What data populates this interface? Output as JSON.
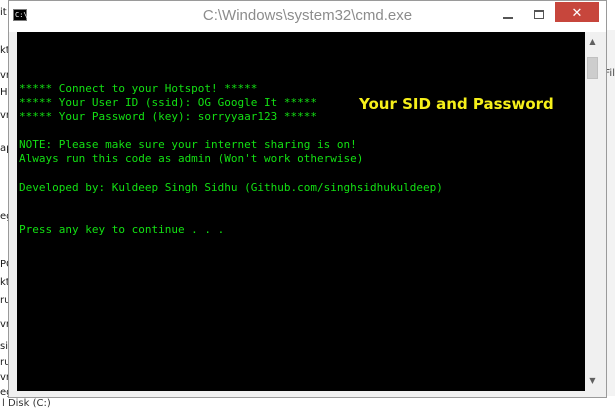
{
  "window": {
    "title": "C:\\Windows\\system32\\cmd.exe",
    "icon_label": "C:\\",
    "minimize_icon": "minimize-icon",
    "maximize_icon": "maximize-icon",
    "close_icon": "close-icon",
    "close_glyph": "✕"
  },
  "console": {
    "lines": [
      "***** Connect to your Hotspot! *****",
      "***** Your User ID (ssid): OG Google It *****",
      "***** Your Password (key): sorryyaar123 *****",
      "",
      "NOTE: Please make sure your internet sharing is on!",
      "Always run this code as admin (Won't work otherwise)",
      "",
      "Developed by: Kuldeep Singh Sidhu (Github.com/singhsidhukuldeep)",
      "",
      "",
      "Press any key to continue . . ."
    ],
    "text_color": "#13e013",
    "background": "#000000"
  },
  "annotation": {
    "text": "Your SID and Password",
    "color": "#f6f01a"
  },
  "background": {
    "left_fragments": [
      "it",
      "kt",
      "vr",
      "Hu",
      "vr",
      "ap",
      "eg",
      "PC",
      "kt",
      "ru",
      "vr",
      "si",
      "ru",
      "vr",
      "eg"
    ],
    "right_fragment": "Fil",
    "bottom_fragment": "l Disk (C:)"
  }
}
